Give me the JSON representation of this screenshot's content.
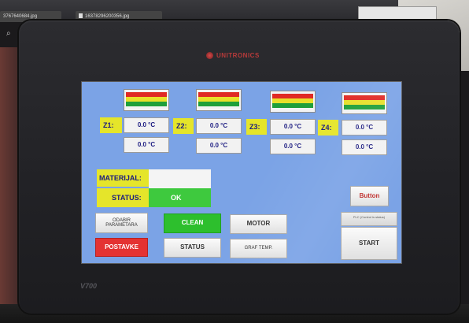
{
  "browser": {
    "tab1": "3767640684.jpg",
    "tab2": "16378296200356.jpg"
  },
  "device": {
    "brand": "UNITRONICS",
    "model": "V700"
  },
  "zones": [
    {
      "label": "Z1:",
      "temp_top": "0.0 °C",
      "temp_bottom": "0.0 °C"
    },
    {
      "label": "Z2:",
      "temp_top": "0.0 °C",
      "temp_bottom": "0.0 °C"
    },
    {
      "label": "Z3:",
      "temp_top": "0.0 °C",
      "temp_bottom": "0.0 °C"
    },
    {
      "label": "Z4:",
      "temp_top": "0.0 °C",
      "temp_bottom": "0.0 °C"
    }
  ],
  "gauge_colors": [
    "#e02a24",
    "#e8e02a",
    "#1f9f3a"
  ],
  "material": {
    "label": "MATERIJAL:",
    "value": ""
  },
  "status": {
    "label": "STATUS:",
    "value": "OK"
  },
  "buttons": {
    "odabir": "ODABIR PARAMETARA",
    "clean": "CLEAN",
    "motor": "MOTOR",
    "postavke": "POSTAVKE",
    "status": "STATUS",
    "graf": "GRAF TEMP.",
    "button": "Button",
    "plc": "PLC (Control is status)",
    "start": "START"
  },
  "colors": {
    "screen_bg": "#7ba3e6",
    "label_yellow": "#e5e52a",
    "ok_green": "#3ec93e",
    "postavke_red": "#e43232"
  }
}
